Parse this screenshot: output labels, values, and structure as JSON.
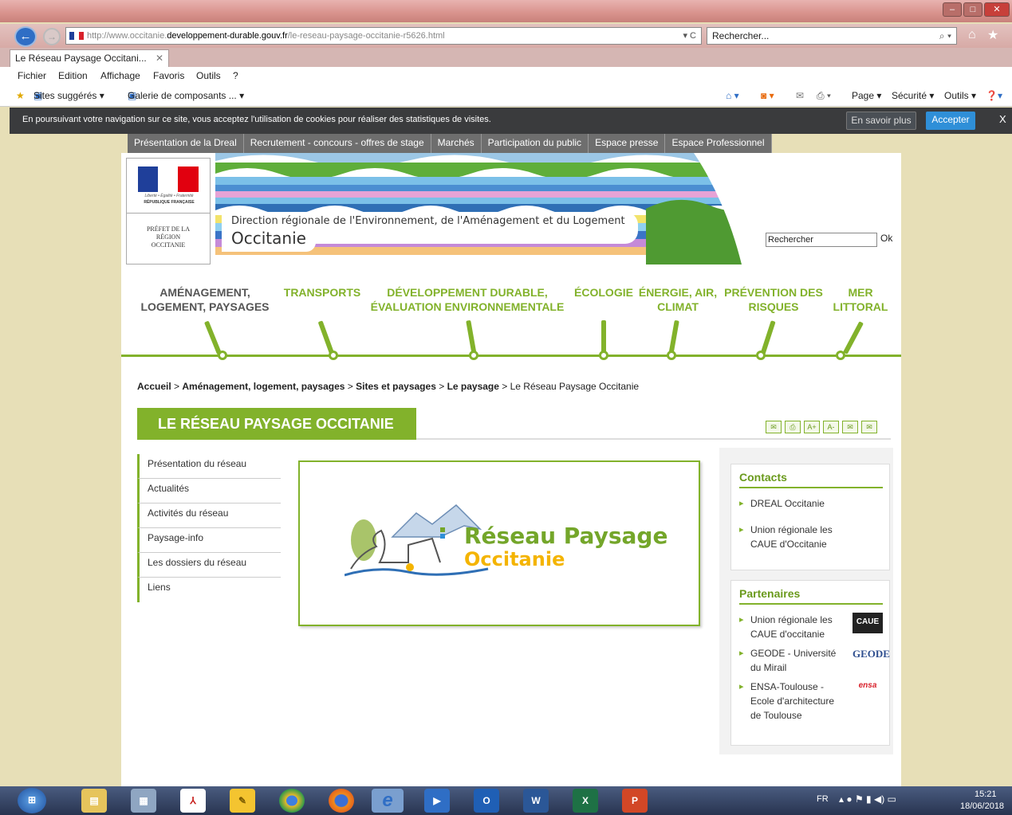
{
  "browser": {
    "url_prefix": "http://www.occitanie.",
    "url_domain": "developpement-durable.gouv.fr",
    "url_path": "/le-reseau-paysage-occitanie-r5626.html",
    "search_placeholder": "Rechercher...",
    "tab_title": "Le Réseau Paysage Occitani...",
    "menu": [
      "Fichier",
      "Edition",
      "Affichage",
      "Favoris",
      "Outils",
      "?"
    ],
    "fav_items": [
      "Sites suggérés ▾",
      "Galerie de composants ... ▾"
    ],
    "cmd_items": [
      "Page ▾",
      "Sécurité ▾",
      "Outils ▾"
    ]
  },
  "cookie": {
    "text": "En poursuivant votre navigation sur ce site, vous acceptez l'utilisation de cookies pour réaliser des statistiques de visites.",
    "learn_more": "En savoir plus",
    "accept": "Accepter",
    "close": "X"
  },
  "topnav": [
    "Présentation de la Dreal",
    "Recrutement - concours - offres de stage",
    "Marchés",
    "Participation du public",
    "Espace presse",
    "Espace Professionnel"
  ],
  "header": {
    "marianne_motto": "Liberté • Égalité • Fraternité",
    "republique": "RÉPUBLIQUE FRANÇAISE",
    "prefet": "PRÉFET DE LA RÉGION OCCITANIE",
    "dreal_line1": "Direction régionale de l'Environnement, de l'Aménagement et du Logement",
    "dreal_line2": "Occitanie",
    "search_placeholder": "Rechercher",
    "search_ok": "Ok"
  },
  "mainnav": [
    {
      "label": "AMÉNAGEMENT,\nLOGEMENT, PAYSAGES"
    },
    {
      "label": "TRANSPORTS"
    },
    {
      "label": "DÉVELOPPEMENT DURABLE,\nÉVALUATION ENVIRONNEMENTALE"
    },
    {
      "label": "ÉCOLOGIE"
    },
    {
      "label": "ÉNERGIE, AIR,\nCLIMAT"
    },
    {
      "label": "PRÉVENTION DES\nRISQUES"
    },
    {
      "label": "MER\nLITTORAL"
    }
  ],
  "breadcrumb": {
    "home": "Accueil",
    "l1": "Aménagement, logement, paysages",
    "l2": "Sites et paysages",
    "l3": "Le paysage",
    "current": "Le Réseau Paysage Occitanie",
    "sep": " > "
  },
  "page_title": "LE RÉSEAU PAYSAGE OCCITANIE",
  "leftnav": [
    "Présentation du réseau",
    "Actualités",
    "Activités du réseau",
    "Paysage-info",
    "Les dossiers du réseau",
    "Liens"
  ],
  "logo": {
    "title": "Réseau Paysage",
    "subtitle": "Occitanie"
  },
  "contacts": {
    "title": "Contacts",
    "links": [
      "DREAL Occitanie",
      "Union régionale les CAUE d'Occitanie"
    ]
  },
  "partners": {
    "title": "Partenaires",
    "links": [
      "Union régionale les CAUE d'occitanie",
      "GEODE - Université du Mirail",
      "ENSA-Toulouse - Ecole d'architecture de Toulouse"
    ],
    "logos": [
      "CAUE",
      "GEODE",
      "ensa"
    ]
  },
  "taskbar": {
    "lang": "FR",
    "time": "15:21",
    "date": "18/06/2018",
    "apps": [
      "O",
      "W",
      "X",
      "P"
    ]
  },
  "colors": {
    "accent": "#82b22b",
    "accent_dark": "#6a9a1c",
    "cookie_bg": "#3a3b3d",
    "accept": "#2f8fd8"
  }
}
